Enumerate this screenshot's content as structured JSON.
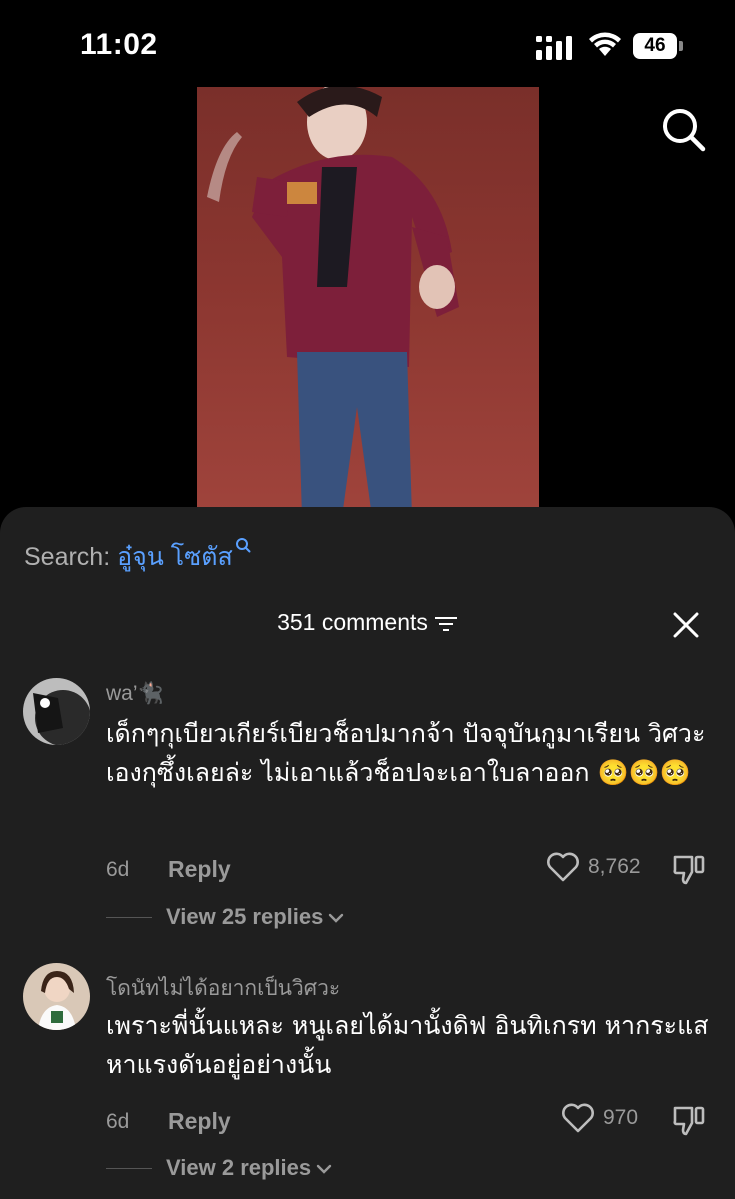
{
  "status_bar": {
    "time": "11:02",
    "battery": "46"
  },
  "icons": {
    "top_search": "search-icon",
    "close": "close-icon",
    "filter": "filter-icon",
    "heart": "heart-icon",
    "dislike": "dislike-icon"
  },
  "sheet": {
    "search_prefix": "Search: ",
    "search_query": "อู๋จุน โซตัส",
    "header": "351 comments"
  },
  "comments": [
    {
      "username": "wa’🐈‍⬛",
      "text": "เด็กๆกุเบียวเกียร์เบียวช็อปมากจ้า ปัจจุบันกูมาเรียน วิศวะเองกุซึ้งเลยล่ะ ไม่เอาแล้วช็อปจะเอาใบลาออก 🥺🥺🥺",
      "age": "6d",
      "reply": "Reply",
      "likes": "8,762",
      "view_replies": "View 25 replies"
    },
    {
      "username": "โดนัทไม่ได้อยากเป็นวิศวะ",
      "text": "เพราะพี่นั้นแหละ หนูเลยได้มานั้งดิฟ อินทิเกรท หากระแส หาแรงดันอยู่อย่างนั้น",
      "age": "6d",
      "reply": "Reply",
      "likes": "970",
      "view_replies": "View 2 replies"
    }
  ]
}
